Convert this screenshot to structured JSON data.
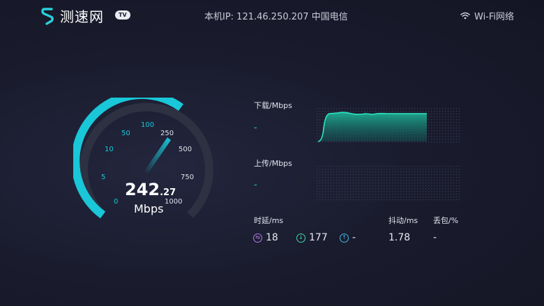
{
  "header": {
    "app_name": "测速网",
    "badge": "TV",
    "ip_info": "本机IP: 121.46.250.207  中国电信",
    "network": "Wi-Fi网络"
  },
  "gauge": {
    "ticks": [
      "0",
      "5",
      "10",
      "50",
      "100",
      "250",
      "500",
      "750",
      "1000"
    ],
    "speed_int": "242",
    "speed_dec": ".27",
    "unit": "Mbps",
    "accent_color": "#19c7d8"
  },
  "download": {
    "label": "下载/Mbps",
    "value": "-"
  },
  "upload": {
    "label": "上传/Mbps",
    "value": "-"
  },
  "latency": {
    "label": "时延/ms",
    "idle": "18",
    "down": "177",
    "up": "-"
  },
  "jitter": {
    "label": "抖动/ms",
    "value": "1.78"
  },
  "loss": {
    "label": "丢包/%",
    "value": "-"
  }
}
